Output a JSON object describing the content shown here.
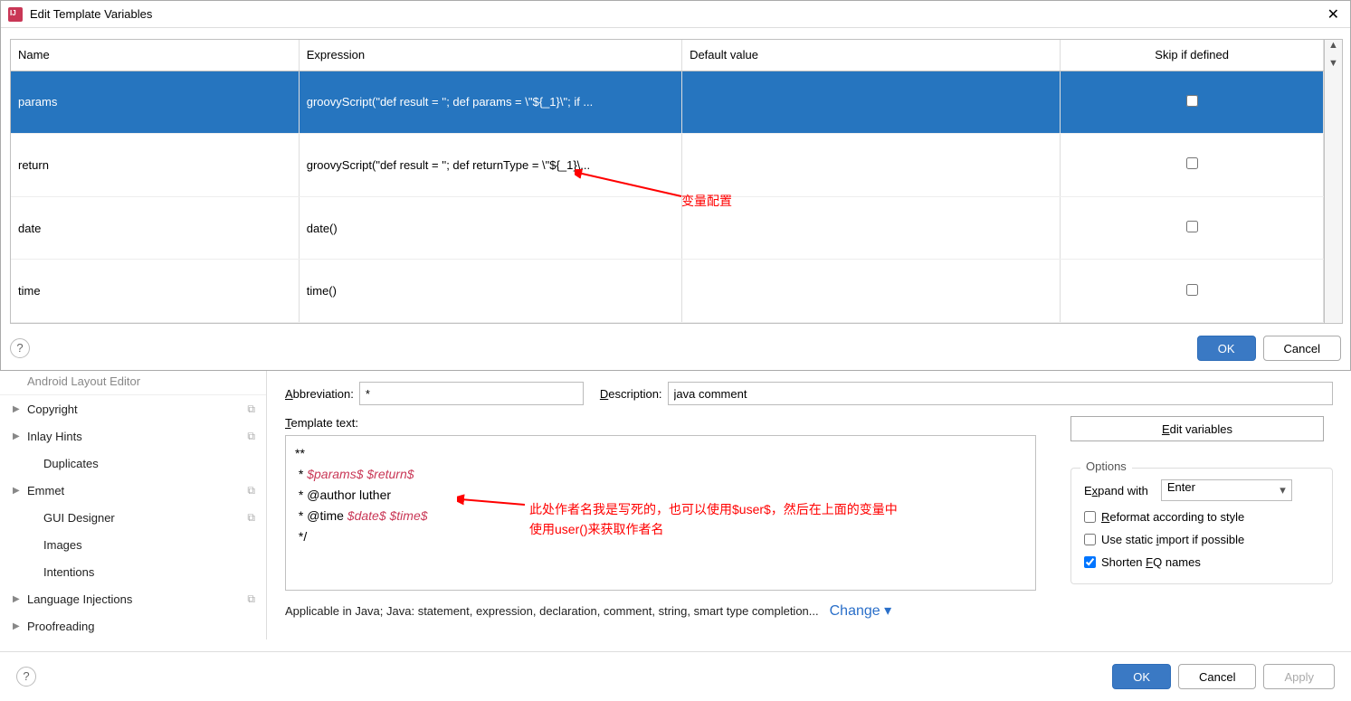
{
  "dialog": {
    "title": "Edit Template Variables",
    "close": "✕",
    "headers": {
      "name": "Name",
      "expression": "Expression",
      "default": "Default value",
      "skip": "Skip if defined"
    },
    "rows": [
      {
        "name": "params",
        "expression": "groovyScript(\"def result = ''; def params = \\\"${_1}\\\"; if ...",
        "default": "",
        "skip": false
      },
      {
        "name": "return",
        "expression": "groovyScript(\"def result = ''; def returnType = \\\"${_1}\\...",
        "default": "",
        "skip": false
      },
      {
        "name": "date",
        "expression": "date()",
        "default": "",
        "skip": false
      },
      {
        "name": "time",
        "expression": "time()",
        "default": "",
        "skip": false
      }
    ],
    "up": "▲",
    "down": "▼",
    "ok": "OK",
    "cancel": "Cancel",
    "help": "?"
  },
  "annotation1": "变量配置",
  "sidebar": {
    "items": [
      {
        "label": "Android Layout Editor",
        "expand": false,
        "copy": false,
        "cut": true
      },
      {
        "label": "Copyright",
        "expand": true,
        "copy": true
      },
      {
        "label": "Inlay Hints",
        "expand": true,
        "copy": true
      },
      {
        "label": "Duplicates",
        "expand": false,
        "copy": false,
        "indent": true
      },
      {
        "label": "Emmet",
        "expand": true,
        "copy": true
      },
      {
        "label": "GUI Designer",
        "expand": false,
        "copy": true,
        "indent": true
      },
      {
        "label": "Images",
        "expand": false,
        "copy": false,
        "indent": true
      },
      {
        "label": "Intentions",
        "expand": false,
        "copy": false,
        "indent": true
      },
      {
        "label": "Language Injections",
        "expand": true,
        "copy": true
      },
      {
        "label": "Proofreading",
        "expand": true,
        "copy": false
      }
    ]
  },
  "form": {
    "abbreviation_label": "Abbreviation:",
    "abbreviation_value": "*",
    "description_label": "Description:",
    "description_value": "java comment",
    "template_label": "Template text:",
    "edit_vars": "Edit variables",
    "template_lines": {
      "l1": "**",
      "l2a": " * ",
      "l2b": "$params$",
      "l2c": " ",
      "l2d": "$return$",
      "l3a": " * @author luther",
      "l4a": " * @time ",
      "l4b": "$date$",
      "l4c": " ",
      "l4d": "$time$",
      "l5": " */"
    },
    "applicable": "Applicable in Java; Java: statement, expression, declaration, comment, string, smart type completion...",
    "change": "Change ▾"
  },
  "options": {
    "title": "Options",
    "expand_label": "Expand with",
    "expand_value": "Enter",
    "reformat": "Reformat according to style",
    "static_import": "Use static import if possible",
    "shorten_fq": "Shorten FQ names"
  },
  "annotation2": "此处作者名我是写死的，也可以使用$user$，然后在上面的变量中使用user()来获取作者名",
  "bottom": {
    "ok": "OK",
    "cancel": "Cancel",
    "apply": "Apply",
    "help": "?"
  }
}
